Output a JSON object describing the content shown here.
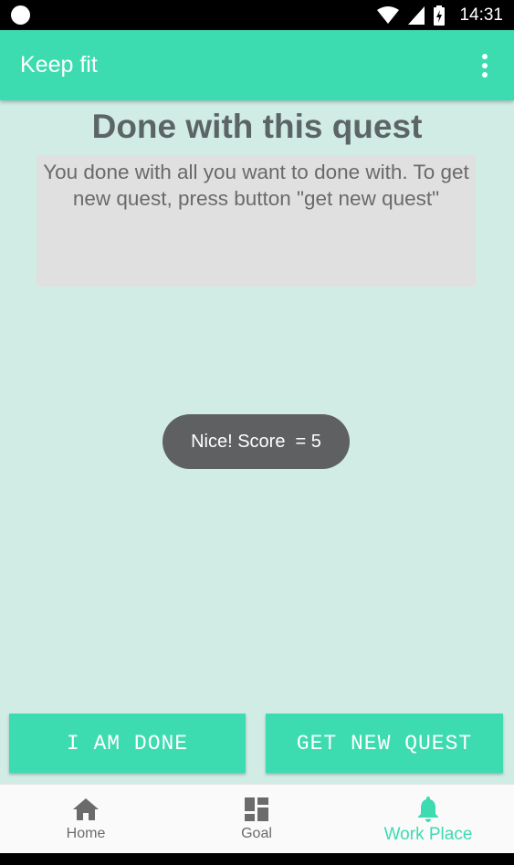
{
  "status_bar": {
    "time": "14:31",
    "icons": [
      "notification-dot-icon",
      "wifi-icon",
      "cellular-signal-icon",
      "battery-charging-icon"
    ]
  },
  "app_bar": {
    "title": "Keep fit",
    "menu_icon": "overflow-menu-icon"
  },
  "quest": {
    "title": "Done with this quest",
    "description": "You done with all you want to done with. To get new quest, press button \"get new quest\""
  },
  "toast": {
    "text": "Nice! Score  = 5"
  },
  "actions": {
    "done_label": "I AM DONE",
    "new_quest_label": "GET NEW QUEST"
  },
  "bottom_nav": {
    "items": [
      {
        "label": "Home",
        "icon": "home-icon",
        "active": false
      },
      {
        "label": "Goal",
        "icon": "dashboard-icon",
        "active": false
      },
      {
        "label": "Work Place",
        "icon": "bell-icon",
        "active": true
      }
    ]
  },
  "colors": {
    "accent": "#3ddbb0",
    "background": "#d1ece5",
    "title_text": "#5c6566",
    "toast_bg": "#5f6062"
  }
}
